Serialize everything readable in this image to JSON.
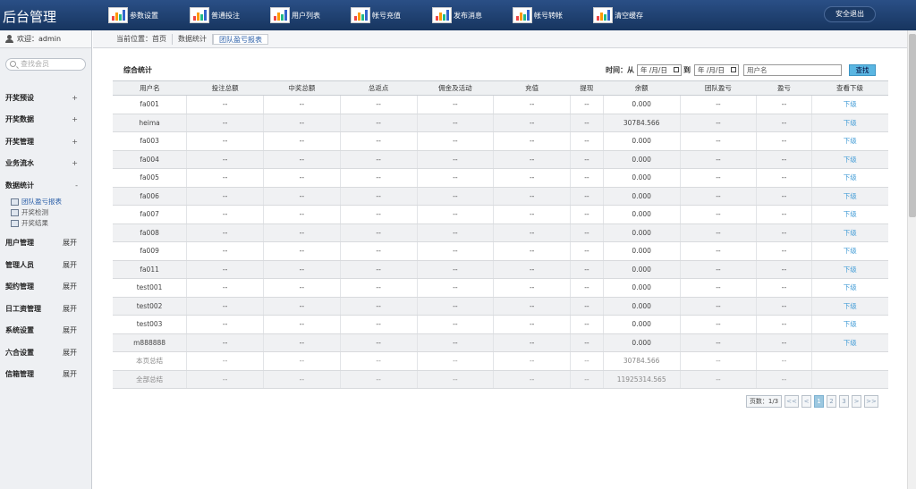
{
  "app": {
    "title": "后台管理",
    "logout_label": "安全退出"
  },
  "topnav": [
    {
      "label": "参数设置",
      "icon": "chart-icon"
    },
    {
      "label": "普通投注",
      "icon": "chart-icon"
    },
    {
      "label": "用户列表",
      "icon": "chart-icon"
    },
    {
      "label": "帐号充值",
      "icon": "chart-icon"
    },
    {
      "label": "发布消息",
      "icon": "chart-icon"
    },
    {
      "label": "帐号转帐",
      "icon": "chart-icon"
    },
    {
      "label": "清空缓存",
      "icon": "chart-icon"
    }
  ],
  "sidebar": {
    "welcome": "欢迎：admin",
    "search_placeholder": "查找会员",
    "items": [
      {
        "label": "开奖预设",
        "sign": "+"
      },
      {
        "label": "开奖数据",
        "sign": "+"
      },
      {
        "label": "开奖管理",
        "sign": "+"
      },
      {
        "label": "业务流水",
        "sign": "+"
      },
      {
        "label": "数据统计",
        "sign": "-"
      }
    ],
    "subitems": [
      {
        "label": "团队盈亏报表"
      },
      {
        "label": "开奖检测"
      },
      {
        "label": "开奖结果"
      }
    ],
    "more": [
      {
        "label": "用户管理",
        "sign": "展开"
      },
      {
        "label": "管理人员",
        "sign": "展开"
      },
      {
        "label": "契约管理",
        "sign": "展开"
      },
      {
        "label": "日工资管理",
        "sign": "展开"
      },
      {
        "label": "系统设置",
        "sign": "展开"
      },
      {
        "label": "六合设置",
        "sign": "展开"
      },
      {
        "label": "信箱管理",
        "sign": "展开"
      }
    ]
  },
  "breadcrumb": {
    "prefix": "当前位置：首页",
    "level2": "数据统计",
    "current": "团队盈亏报表"
  },
  "panel": {
    "title": "综合统计",
    "time_label": "时间：从",
    "to_label": "到",
    "date_placeholder": "年 /月/日",
    "name_placeholder": "用户名",
    "find_label": "查找"
  },
  "table": {
    "headers": [
      "用户名",
      "投注总额",
      "中奖总额",
      "总返点",
      "佣金及活动",
      "充值",
      "提现",
      "余额",
      "团队盈亏",
      "盈亏",
      "查看下级"
    ],
    "rows": [
      [
        "fa001",
        "--",
        "--",
        "--",
        "--",
        "--",
        "--",
        "0.000",
        "--",
        "--",
        "下级"
      ],
      [
        "heima",
        "--",
        "--",
        "--",
        "--",
        "--",
        "--",
        "30784.566",
        "--",
        "--",
        "下级"
      ],
      [
        "fa003",
        "--",
        "--",
        "--",
        "--",
        "--",
        "--",
        "0.000",
        "--",
        "--",
        "下级"
      ],
      [
        "fa004",
        "--",
        "--",
        "--",
        "--",
        "--",
        "--",
        "0.000",
        "--",
        "--",
        "下级"
      ],
      [
        "fa005",
        "--",
        "--",
        "--",
        "--",
        "--",
        "--",
        "0.000",
        "--",
        "--",
        "下级"
      ],
      [
        "fa006",
        "--",
        "--",
        "--",
        "--",
        "--",
        "--",
        "0.000",
        "--",
        "--",
        "下级"
      ],
      [
        "fa007",
        "--",
        "--",
        "--",
        "--",
        "--",
        "--",
        "0.000",
        "--",
        "--",
        "下级"
      ],
      [
        "fa008",
        "--",
        "--",
        "--",
        "--",
        "--",
        "--",
        "0.000",
        "--",
        "--",
        "下级"
      ],
      [
        "fa009",
        "--",
        "--",
        "--",
        "--",
        "--",
        "--",
        "0.000",
        "--",
        "--",
        "下级"
      ],
      [
        "fa011",
        "--",
        "--",
        "--",
        "--",
        "--",
        "--",
        "0.000",
        "--",
        "--",
        "下级"
      ],
      [
        "test001",
        "--",
        "--",
        "--",
        "--",
        "--",
        "--",
        "0.000",
        "--",
        "--",
        "下级"
      ],
      [
        "test002",
        "--",
        "--",
        "--",
        "--",
        "--",
        "--",
        "0.000",
        "--",
        "--",
        "下级"
      ],
      [
        "test003",
        "--",
        "--",
        "--",
        "--",
        "--",
        "--",
        "0.000",
        "--",
        "--",
        "下级"
      ],
      [
        "m888888",
        "--",
        "--",
        "--",
        "--",
        "--",
        "--",
        "0.000",
        "--",
        "--",
        "下级"
      ]
    ],
    "summary": [
      [
        "本页总结",
        "--",
        "--",
        "--",
        "--",
        "--",
        "--",
        "30784.566",
        "--",
        "--",
        ""
      ],
      [
        "全部总结",
        "--",
        "--",
        "--",
        "--",
        "--",
        "--",
        "11925314.565",
        "--",
        "--",
        ""
      ]
    ]
  },
  "pager": {
    "info": "页数：1/3",
    "first": "<<",
    "prev": "<",
    "pages": [
      "1",
      "2",
      "3"
    ],
    "next": ">",
    "last": ">>"
  }
}
